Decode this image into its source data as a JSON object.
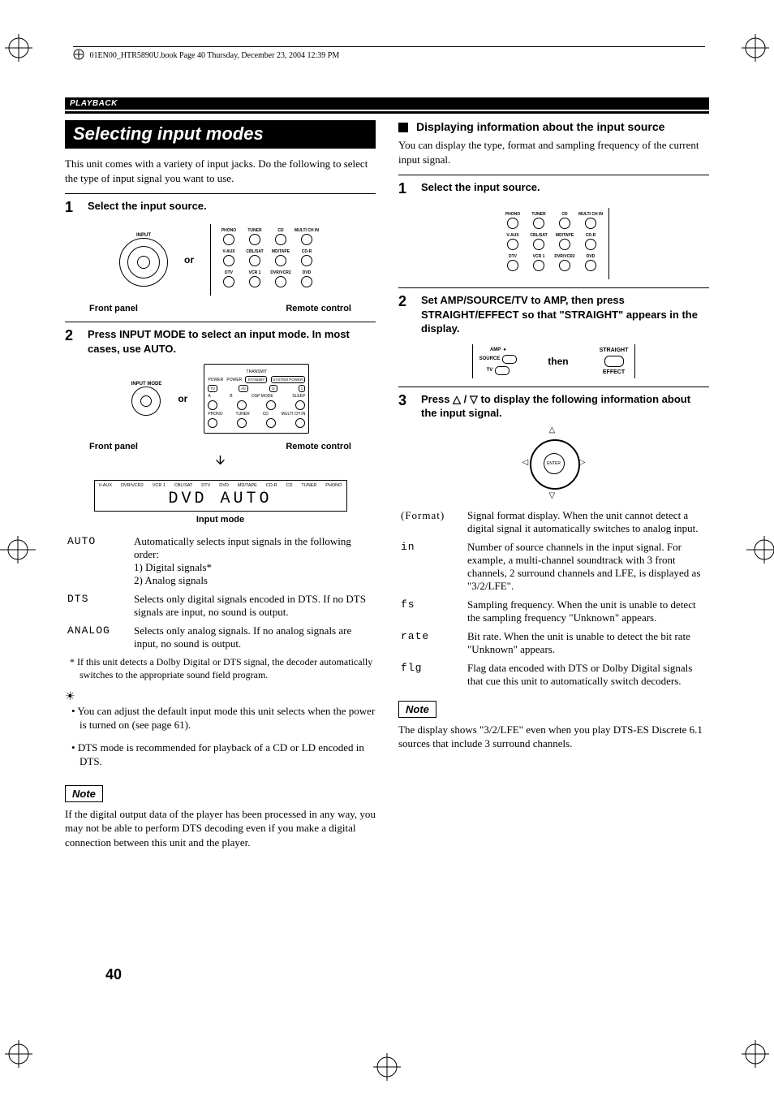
{
  "header": "01EN00_HTR5890U.book  Page 40  Thursday, December 23, 2004  12:39 PM",
  "section": "PLAYBACK",
  "left": {
    "title": "Selecting input modes",
    "intro": "This unit comes with a variety of input jacks. Do the following to select the type of input signal you want to use.",
    "step1": {
      "num": "1",
      "text": "Select the input source."
    },
    "fig1": {
      "front_lbl": "INPUT",
      "or": "or",
      "front_panel": "Front panel",
      "remote_control": "Remote control",
      "remote_btns": [
        [
          "PHONO",
          "TUNER",
          "CD",
          "MULTI CH IN"
        ],
        [
          "V-AUX",
          "CBL/SAT",
          "MD/TAPE",
          "CD-R"
        ],
        [
          "DTV",
          "VCR 1",
          "DVR/VCR2",
          "DVD"
        ]
      ]
    },
    "step2": {
      "num": "2",
      "text": "Press INPUT MODE to select an input mode. In most cases, use AUTO."
    },
    "fig2": {
      "front_lbl": "INPUT MODE",
      "or": "or",
      "front_panel": "Front panel",
      "remote_control": "Remote control",
      "remote_labels": {
        "transmit": "TRANSMIT",
        "power1": "POWER",
        "power2": "POWER",
        "standby": "STANDBY",
        "system": "SYSTEM POWER",
        "tv": "TV",
        "av": "AV",
        "opt": "",
        "one": "1",
        "a": "A",
        "b": "B",
        "dspmode": "DSP MODE",
        "sleep": "SLEEP",
        "phono": "PHONO",
        "tuner": "TUNER",
        "cd": "CD",
        "multi": "MULTI CH IN"
      }
    },
    "display": {
      "labels": [
        "V-AUX",
        "DVR/VCR2",
        "VCR 1",
        "CBL/SAT",
        "DTV",
        "DVD",
        "MD/TAPE",
        "CD-R",
        "CD",
        "TUNER",
        "PHONO"
      ],
      "seg": "DVD  AUTO",
      "caption": "Input mode"
    },
    "modes": [
      {
        "k": "AUTO",
        "v": "Automatically selects input signals in the following order:",
        "v2": "1) Digital signals*",
        "v3": "2) Analog signals"
      },
      {
        "k": "DTS",
        "v": "Selects only digital signals encoded in DTS. If no DTS signals are input, no sound is output."
      },
      {
        "k": "ANALOG",
        "v": "Selects only analog signals. If no analog signals are input, no sound is output."
      }
    ],
    "footnote": "*   If this unit detects a Dolby Digital or DTS signal, the decoder automatically switches to the appropriate sound field program.",
    "tips": [
      "You can adjust the default input mode this unit selects when the power is turned on (see page 61).",
      "DTS mode is recommended for playback of a CD or LD encoded in DTS."
    ],
    "note_label": "Note",
    "note_text": "If the digital output data of the player has been processed in any way, you may not be able to perform DTS decoding even if you make a digital connection between this unit and the player."
  },
  "right": {
    "heading": "Displaying information about the input source",
    "intro": "You can display the type, format and sampling frequency of the current input signal.",
    "step1": {
      "num": "1",
      "text": "Select the input source."
    },
    "step2": {
      "num": "2",
      "text": "Set AMP/SOURCE/TV to AMP, then press STRAIGHT/EFFECT so that \"STRAIGHT\" appears in the display."
    },
    "amp": {
      "amp": "AMP",
      "source": "SOURCE",
      "tv": "TV"
    },
    "then": "then",
    "straight": "STRAIGHT",
    "effect": "EFFECT",
    "step3": {
      "num": "3",
      "text_prefix": "Press ",
      "text_mid": " / ",
      "text_suffix": " to display the following information about the input signal."
    },
    "dpad_center": "ENTER",
    "info": [
      {
        "k": "(Format)",
        "v": "Signal format display. When the unit cannot detect a digital signal it automatically switches to analog input."
      },
      {
        "k": "in",
        "v": "Number of source channels in the input signal. For example, a multi-channel soundtrack with 3 front channels, 2 surround channels and LFE, is displayed as \"3/2/LFE\"."
      },
      {
        "k": "fs",
        "v": "Sampling frequency. When the unit is unable to detect the sampling frequency \"Unknown\" appears."
      },
      {
        "k": "rate",
        "v": "Bit rate. When the unit is unable to detect the bit rate \"Unknown\" appears."
      },
      {
        "k": "flg",
        "v": "Flag data encoded with DTS or Dolby Digital signals that cue this unit to automatically switch decoders."
      }
    ],
    "note_label": "Note",
    "note_text": "The display shows \"3/2/LFE\" even when you play DTS-ES Discrete 6.1 sources that include 3 surround channels."
  },
  "page_number": "40"
}
